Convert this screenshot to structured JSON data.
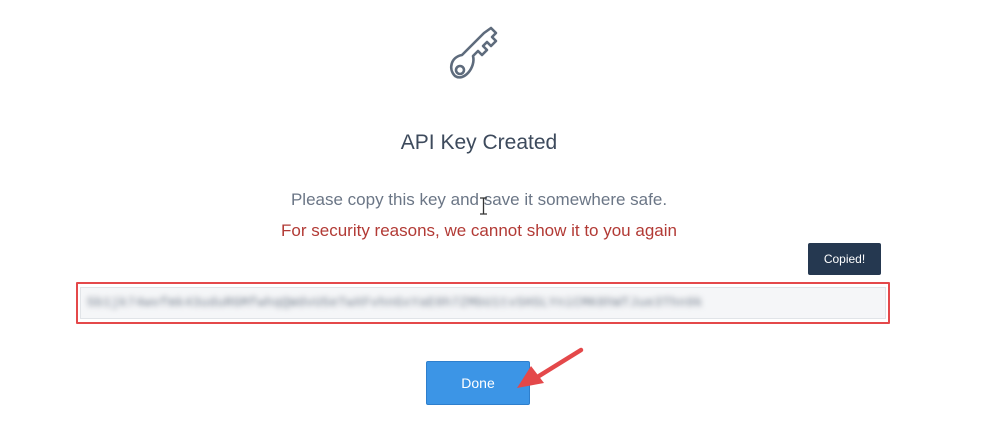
{
  "dialog": {
    "icon": "key-icon",
    "title": "API Key Created",
    "instruction": "Please copy this key and save it somewhere safe.",
    "warning": "For security reasons, we cannot show it to you again",
    "tooltip": "Copied!",
    "api_key_blurred": "5b1jk74wvfmk43uduRGMfwhqQWdvU5eTwXFvhnGxYaE0h7ZMbU1tvSHSLYniCMK8hWTJue3Thn9k",
    "done_label": "Done"
  },
  "colors": {
    "title": "#3d4a5c",
    "instruction": "#6b7686",
    "warning": "#b23a35",
    "tooltip_bg": "#253850",
    "highlight_border": "#e4484a",
    "button_bg": "#3c95e6",
    "annotation_arrow": "#e4484a"
  }
}
